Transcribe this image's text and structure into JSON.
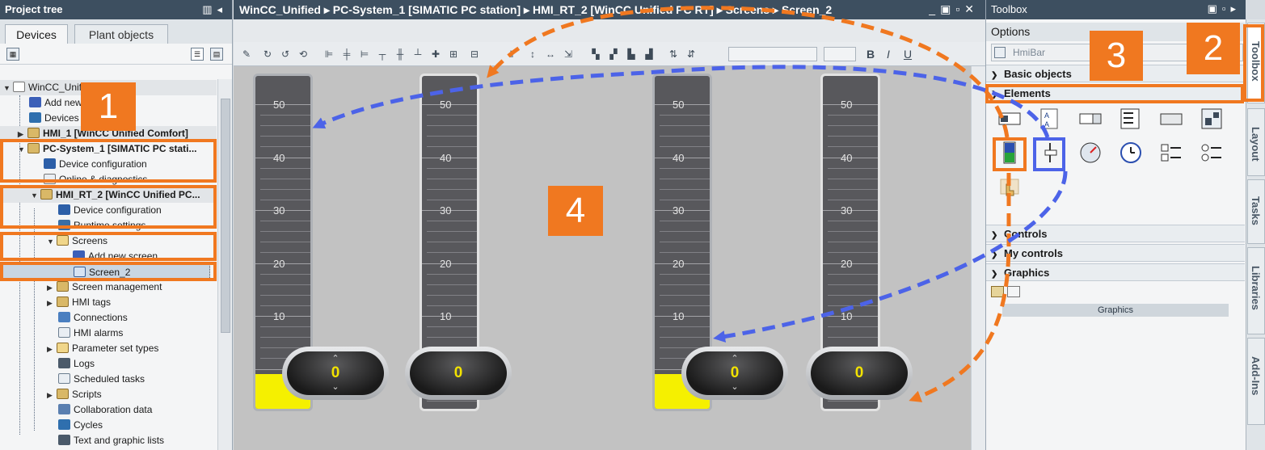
{
  "project_tree": {
    "title": "Project tree",
    "tabs": [
      "Devices",
      "Plant objects"
    ],
    "items": [
      {
        "label": "WinCC_Unified..."
      },
      {
        "label": "Add new device"
      },
      {
        "label": "Devices & networks"
      },
      {
        "label": "HMI_1 [WinCC Unified Comfort]"
      },
      {
        "label": "PC-System_1 [SIMATIC PC stati..."
      },
      {
        "label": "Device configuration"
      },
      {
        "label": "Online & diagnostics"
      },
      {
        "label": "HMI_RT_2 [WinCC Unified PC..."
      },
      {
        "label": "Device configuration"
      },
      {
        "label": "Runtime settings"
      },
      {
        "label": "Screens"
      },
      {
        "label": "Add new screen"
      },
      {
        "label": "Screen_2"
      },
      {
        "label": "Screen management"
      },
      {
        "label": "HMI tags"
      },
      {
        "label": "Connections"
      },
      {
        "label": "HMI alarms"
      },
      {
        "label": "Parameter set types"
      },
      {
        "label": "Logs"
      },
      {
        "label": "Scheduled tasks"
      },
      {
        "label": "Scripts"
      },
      {
        "label": "Collaboration data"
      },
      {
        "label": "Cycles"
      },
      {
        "label": "Text and graphic lists"
      }
    ]
  },
  "editor": {
    "breadcrumb": [
      "WinCC_Unified",
      "PC-System_1 [SIMATIC PC station]",
      "HMI_RT_2 [WinCC Unified PC RT]",
      "Screens",
      "Screen_2"
    ],
    "toolbar": {
      "bold": "B",
      "italic": "I",
      "underline": "U"
    },
    "gauges": [
      {
        "labels": [
          "50",
          "40",
          "30",
          "20",
          "10"
        ],
        "fill": 0.05,
        "value": "0",
        "spin": true
      },
      {
        "labels": [
          "50",
          "40",
          "30",
          "20",
          "10"
        ],
        "fill": 0,
        "value": "0",
        "spin": false
      },
      {
        "labels": [
          "50",
          "40",
          "30",
          "20",
          "10"
        ],
        "fill": 0.05,
        "value": "0",
        "spin": true
      },
      {
        "labels": [
          "50",
          "40",
          "30",
          "20",
          "10"
        ],
        "fill": 0,
        "value": "0",
        "spin": false
      }
    ]
  },
  "toolbox": {
    "title": "Toolbox",
    "options_label": "Options",
    "search_placeholder": "HmiBar",
    "sections": {
      "basic": "Basic objects",
      "elements": "Elements",
      "controls": "Controls",
      "my_controls": "My controls",
      "graphics": "Graphics"
    },
    "graphics_subheader": "Graphics"
  },
  "side_tabs": [
    "Toolbox",
    "Layout",
    "Tasks",
    "Libraries",
    "Add-Ins"
  ],
  "annotations": [
    "1",
    "2",
    "3",
    "4"
  ],
  "colors": {
    "orange": "#f07820",
    "blue": "#4c63e8",
    "gauge_fill": "#f5f000",
    "value": "#f2e200"
  }
}
